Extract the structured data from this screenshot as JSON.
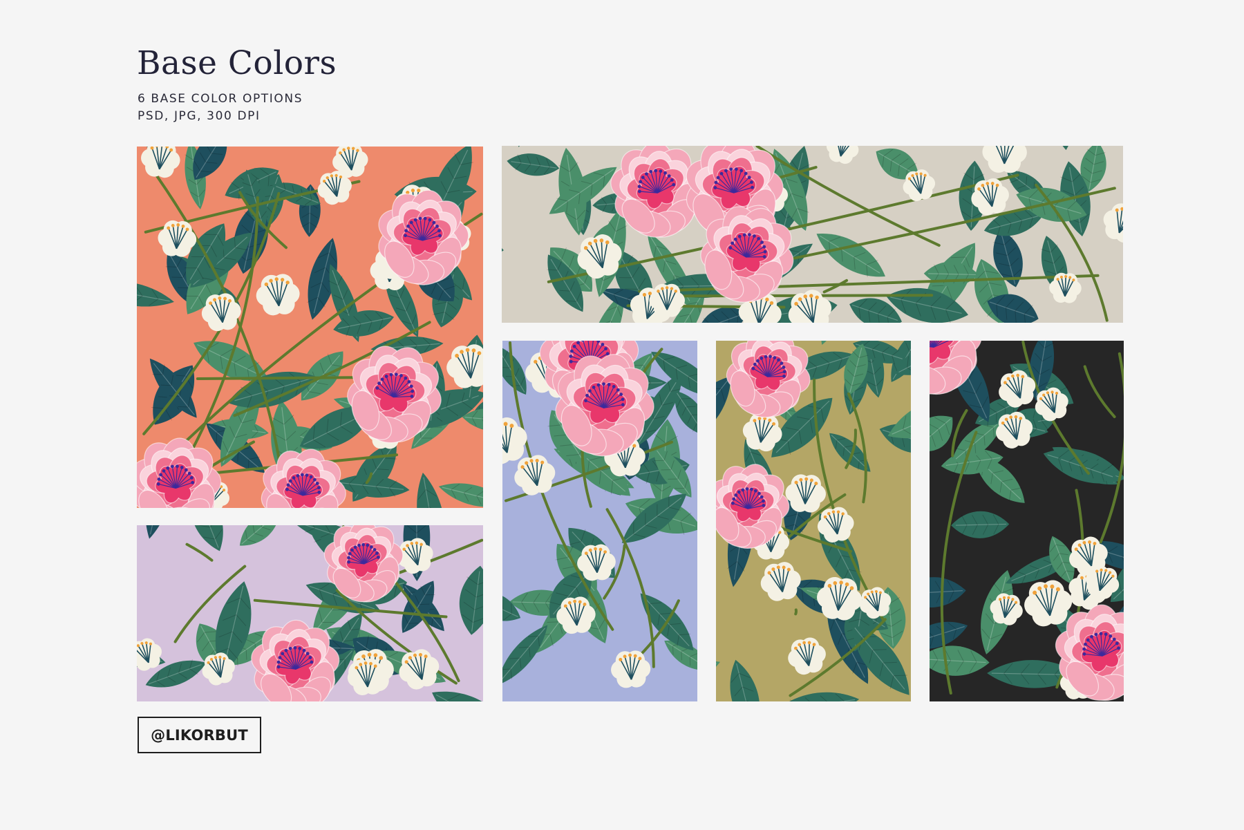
{
  "header": {
    "title": "Base Colors",
    "subtitle_1": "6 BASE COLOR OPTIONS",
    "subtitle_2": "PSD, JPG, 300 DPI"
  },
  "swatches": [
    {
      "name": "coral",
      "base": "#ee8a6c"
    },
    {
      "name": "lilac",
      "base": "#d5c2dc"
    },
    {
      "name": "greige",
      "base": "#d6d0c4"
    },
    {
      "name": "periwinkle",
      "base": "#a8b1dc"
    },
    {
      "name": "olive",
      "base": "#b4a666"
    },
    {
      "name": "charcoal",
      "base": "#262626"
    }
  ],
  "palette": {
    "leaf_dark": "#1e4f5e",
    "leaf_mid": "#2f6e5e",
    "leaf_light": "#4a8f6a",
    "stem": "#5d7a2e",
    "peony_outer": "#f4a7b9",
    "peony_mid": "#ef6f8e",
    "peony_core": "#e8376b",
    "peony_pale": "#fad3dc",
    "stamen": "#3c2a9c",
    "blossom": "#f4f1e4",
    "pollen": "#f0a23a"
  },
  "icons": {
    "pattern_art": "floral-peony-pattern"
  },
  "footer": {
    "handle": "@LIKORBUT"
  }
}
